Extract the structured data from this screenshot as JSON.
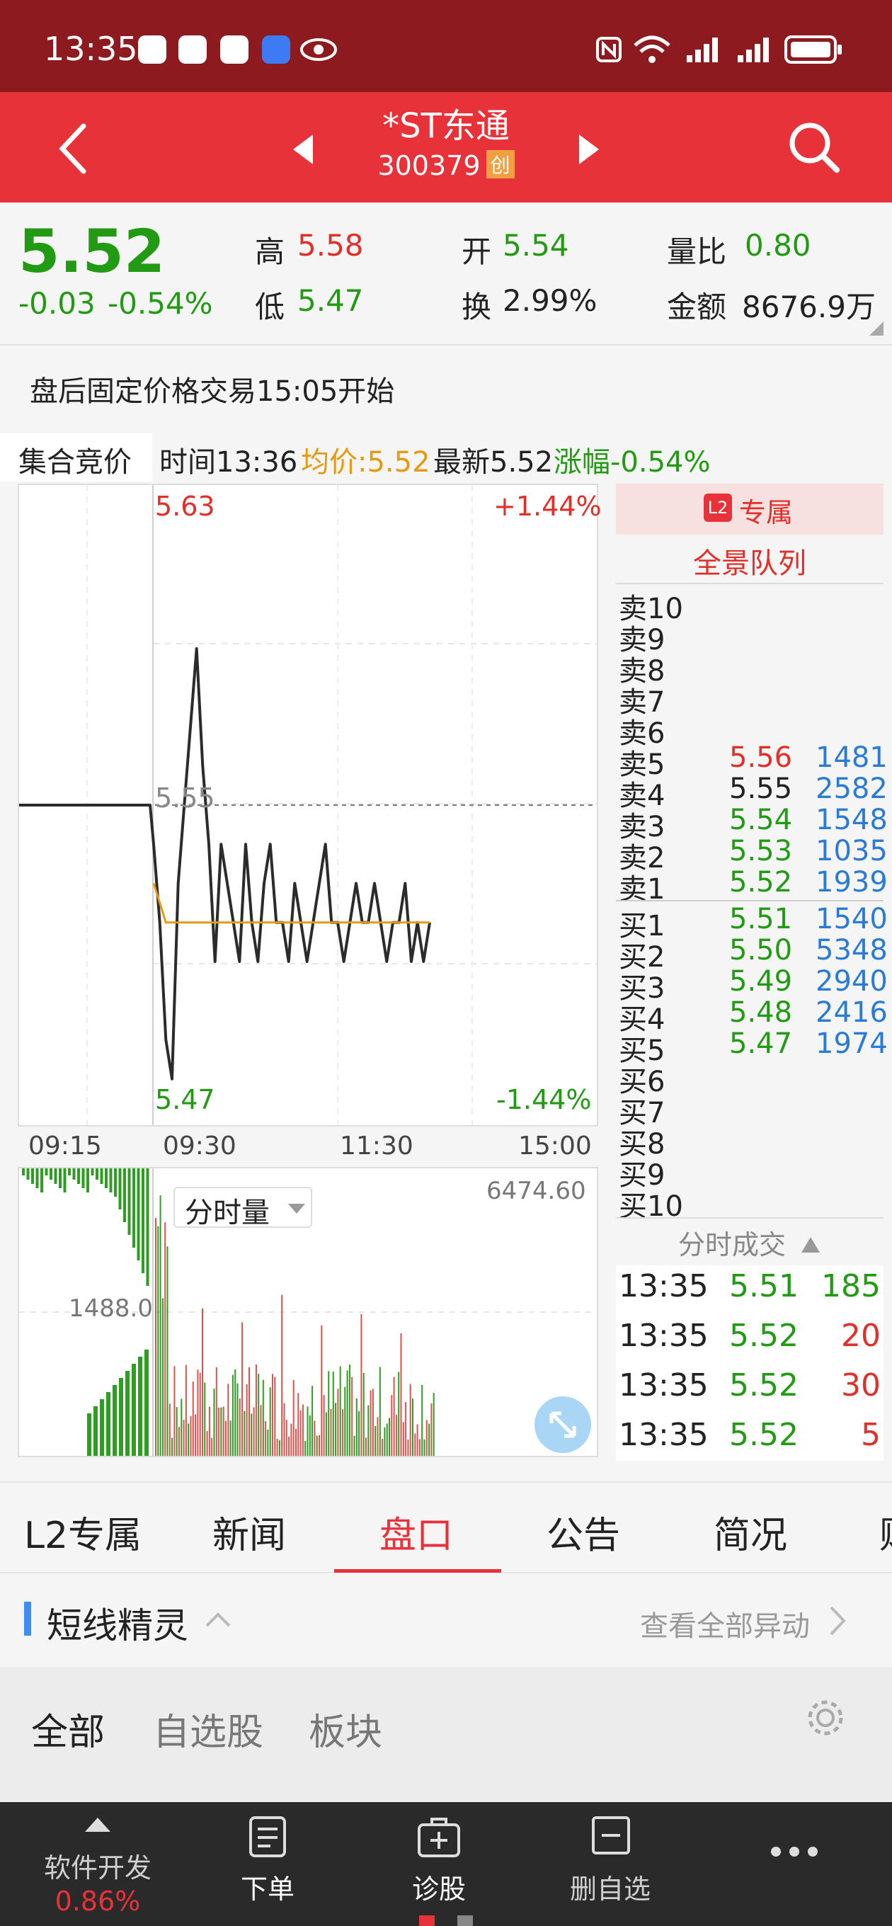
{
  "status": {
    "time": "13:35"
  },
  "header": {
    "name": "*ST东通",
    "code": "300379",
    "badge": "创"
  },
  "quote": {
    "price": "5.52",
    "change": "-0.03",
    "change_pct": "-0.54%",
    "high_label": "高",
    "high": "5.58",
    "low_label": "低",
    "low": "5.47",
    "open_label": "开",
    "open": "5.54",
    "turnover_label": "换",
    "turnover": "2.99%",
    "vol_ratio_label": "量比",
    "vol_ratio": "0.80",
    "amount_label": "金额",
    "amount": "8676.9万"
  },
  "notice": "盘后固定价格交易15:05开始",
  "infobar": {
    "tab_label": "集合竞价",
    "time_text": "时间13:36",
    "avg_text": "均价:5.52",
    "latest_text": "最新5.52",
    "change_text": "涨幅-0.54%"
  },
  "chart_data": {
    "type": "line",
    "top_price": "5.63",
    "top_pct": "+1.44%",
    "bottom_price": "5.47",
    "bottom_pct": "-1.44%",
    "mid_price": "5.55",
    "ylim": [
      5.47,
      5.63
    ],
    "x_ticks": [
      "09:15",
      "09:30",
      "11:30",
      "15:00"
    ],
    "price_series": [
      5.55,
      5.55,
      5.55,
      5.55,
      5.55,
      5.55,
      5.55,
      5.55,
      5.55,
      5.55,
      5.55,
      5.55,
      5.55,
      5.54,
      5.52,
      5.49,
      5.48,
      5.53,
      5.55,
      5.57,
      5.59,
      5.56,
      5.54,
      5.51,
      5.54,
      5.53,
      5.52,
      5.51,
      5.54,
      5.52,
      5.51,
      5.53,
      5.54,
      5.52,
      5.52,
      5.51,
      5.53,
      5.52,
      5.51,
      5.52,
      5.53,
      5.54,
      5.52,
      5.52,
      5.51,
      5.52,
      5.53,
      5.52,
      5.52,
      5.53,
      5.52,
      5.51,
      5.52,
      5.52,
      5.53,
      5.51,
      5.52,
      5.51,
      5.52
    ],
    "avg_series": [
      5.53,
      5.525,
      5.52,
      5.52,
      5.52,
      5.52,
      5.52,
      5.52,
      5.52,
      5.52,
      5.52,
      5.52,
      5.52,
      5.52,
      5.52,
      5.52,
      5.52,
      5.52,
      5.52,
      5.52,
      5.52,
      5.52,
      5.52,
      5.52,
      5.52,
      5.52,
      5.52,
      5.52,
      5.52,
      5.52,
      5.52,
      5.52,
      5.52,
      5.52,
      5.52,
      5.52,
      5.52,
      5.52,
      5.52,
      5.52,
      5.52,
      5.52,
      5.52,
      5.52,
      5.52,
      5.52
    ]
  },
  "volume": {
    "selector": "分时量",
    "max_label": "6474.60",
    "mid_label": "1488.0"
  },
  "orderbook": {
    "header_l2": "L2",
    "header_label": "专属",
    "subheader": "全景队列",
    "asks": [
      {
        "label": "卖10",
        "price": "",
        "vol": ""
      },
      {
        "label": "卖9",
        "price": "",
        "vol": ""
      },
      {
        "label": "卖8",
        "price": "",
        "vol": ""
      },
      {
        "label": "卖7",
        "price": "",
        "vol": ""
      },
      {
        "label": "卖6",
        "price": "",
        "vol": ""
      },
      {
        "label": "卖5",
        "price": "5.56",
        "vol": "1481"
      },
      {
        "label": "卖4",
        "price": "5.55",
        "vol": "2582"
      },
      {
        "label": "卖3",
        "price": "5.54",
        "vol": "1548"
      },
      {
        "label": "卖2",
        "price": "5.53",
        "vol": "1035"
      },
      {
        "label": "卖1",
        "price": "5.52",
        "vol": "1939"
      }
    ],
    "bids": [
      {
        "label": "买1",
        "price": "5.51",
        "vol": "1540"
      },
      {
        "label": "买2",
        "price": "5.50",
        "vol": "5348"
      },
      {
        "label": "买3",
        "price": "5.49",
        "vol": "2940"
      },
      {
        "label": "买4",
        "price": "5.48",
        "vol": "2416"
      },
      {
        "label": "买5",
        "price": "5.47",
        "vol": "1974"
      },
      {
        "label": "买6",
        "price": "",
        "vol": ""
      },
      {
        "label": "买7",
        "price": "",
        "vol": ""
      },
      {
        "label": "买8",
        "price": "",
        "vol": ""
      },
      {
        "label": "买9",
        "price": "",
        "vol": ""
      },
      {
        "label": "买10",
        "price": "",
        "vol": ""
      }
    ],
    "ticks_header": "分时成交",
    "ticks": [
      {
        "time": "13:35",
        "price": "5.51",
        "vol": "185"
      },
      {
        "time": "13:35",
        "price": "5.52",
        "vol": "20"
      },
      {
        "time": "13:35",
        "price": "5.52",
        "vol": "30"
      },
      {
        "time": "13:35",
        "price": "5.52",
        "vol": "5"
      }
    ]
  },
  "tabs": [
    "L2专属",
    "新闻",
    "盘口",
    "公告",
    "简况",
    "财"
  ],
  "active_tab": "盘口",
  "sprite": {
    "title": "短线精灵",
    "link": "查看全部异动"
  },
  "filters": [
    "全部",
    "自选股",
    "板块"
  ],
  "bottomnav": {
    "ticker_name": "软件开发",
    "ticker_pct": "0.86%",
    "order": "下单",
    "diagnose": "诊股",
    "remove": "删自选"
  },
  "colors": {
    "up": "#e0302a",
    "down": "#229a14",
    "accent": "#e8323a"
  }
}
